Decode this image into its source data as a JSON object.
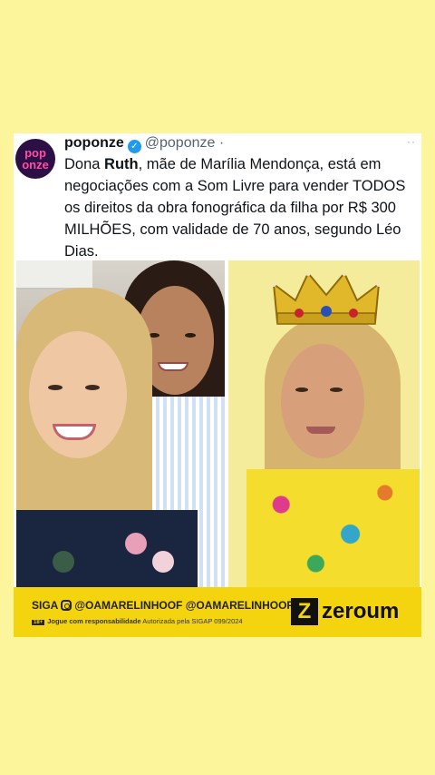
{
  "tweet": {
    "avatar_line1": "pop",
    "avatar_line2": "onze",
    "name": "poponze",
    "handle": "@poponze",
    "dot": "·",
    "more": "··",
    "text_before": "Dona ",
    "text_bold": "Ruth",
    "text_after": ", mãe de Marília Mendonça, está em negociações com a Som Livre para vender TODOS os direitos da obra fonográfica da filha por R$ 300 MILHÕES, com validade de 70 anos, segundo Léo Dias."
  },
  "banner": {
    "siga": "SIGA",
    "handles": "@OAMARELINHOOF @OAMARELINHOOF2",
    "age": "18+",
    "disclaimer_bold": "Jogue com responsabilidade",
    "disclaimer_rest": "Autorizada pela SIGAP 099/2024",
    "brand_mark": "Z",
    "brand_name": "zeroum"
  },
  "colors": {
    "background": "#fcf59c",
    "banner": "#f4d40f",
    "verified": "#1d9bf0",
    "avatar_bg": "#2b0f45",
    "avatar_text": "#ff4fa6"
  },
  "icons": [
    "verified-badge-icon",
    "more-options-icon",
    "instagram-icon"
  ]
}
